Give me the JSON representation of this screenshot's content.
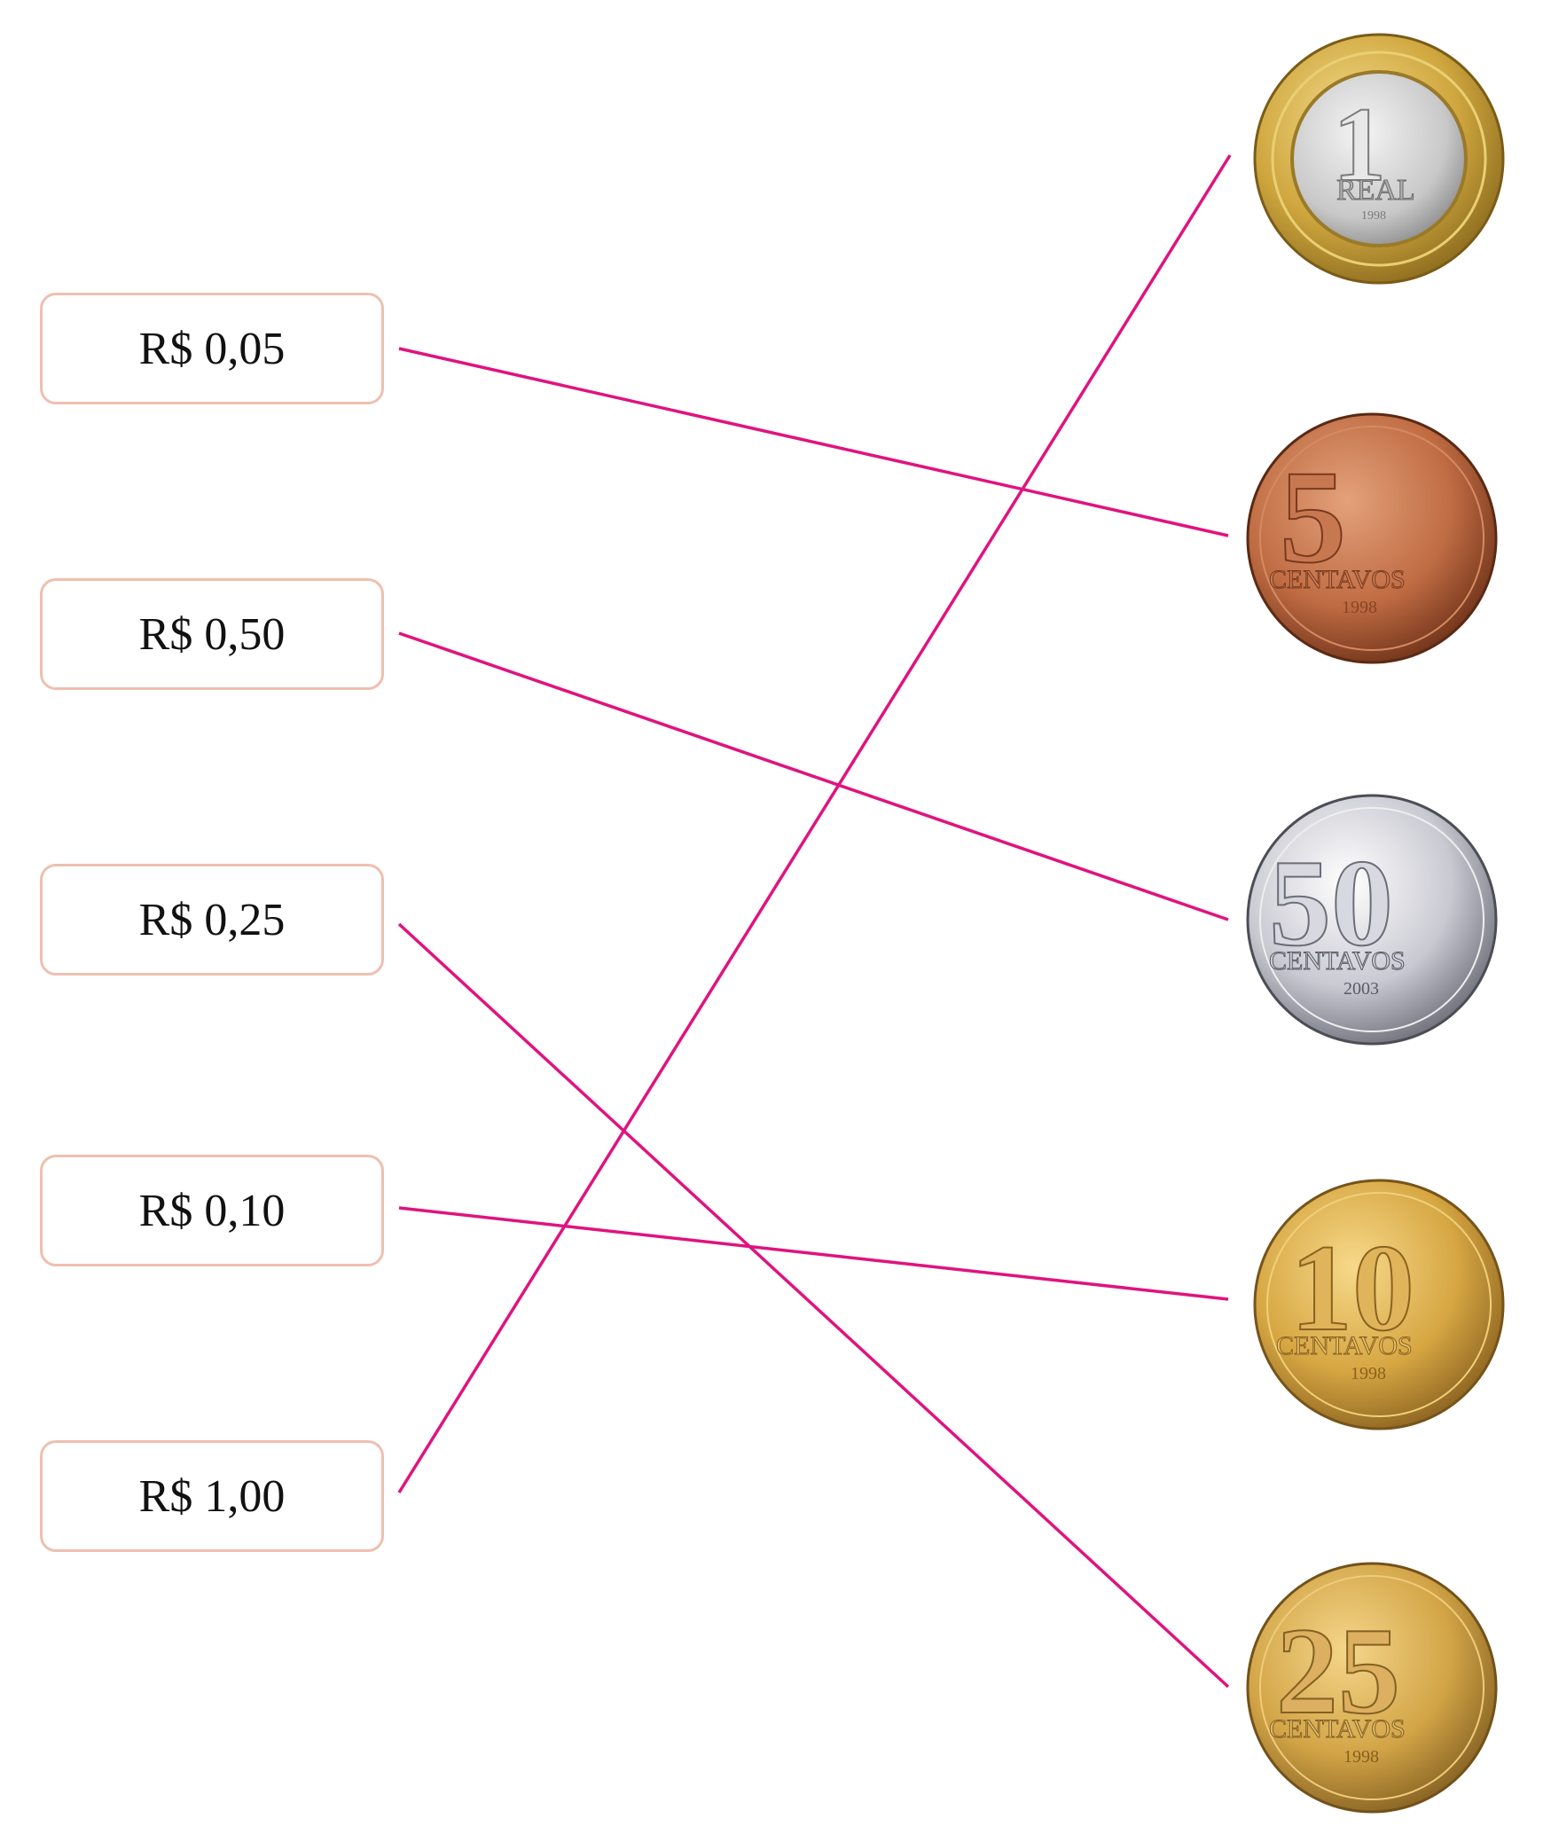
{
  "labels": [
    {
      "id": "0-05",
      "text": "R$ 0,05"
    },
    {
      "id": "0-50",
      "text": "R$ 0,50"
    },
    {
      "id": "0-25",
      "text": "R$ 0,25"
    },
    {
      "id": "0-10",
      "text": "R$ 0,10"
    },
    {
      "id": "1-00",
      "text": "R$ 1,00"
    }
  ],
  "coins": [
    {
      "id": "1-real",
      "numeral": "1",
      "word": "REAL",
      "year": "1998",
      "metal": "bimetal",
      "outer_color": "#c9a43a",
      "inner_color": "#cfcfcf"
    },
    {
      "id": "5-centavos",
      "numeral": "5",
      "word": "CENTAVOS",
      "year": "1998",
      "metal": "copper",
      "outer_color": "#b5683f",
      "inner_color": "#c97a4e"
    },
    {
      "id": "50-centavos",
      "numeral": "50",
      "word": "CENTAVOS",
      "year": "2003",
      "metal": "silver",
      "outer_color": "#a9a9b3",
      "inner_color": "#d9d9e0"
    },
    {
      "id": "10-centavos",
      "numeral": "10",
      "word": "CENTAVOS",
      "year": "1998",
      "metal": "brass",
      "outer_color": "#c99a3a",
      "inner_color": "#ddb356"
    },
    {
      "id": "25-centavos",
      "numeral": "25",
      "word": "CENTAVOS",
      "year": "1998",
      "metal": "brass",
      "outer_color": "#c99a3a",
      "inner_color": "#ddb356"
    }
  ],
  "matches": [
    {
      "label": "R$ 0,05",
      "coin": "5-centavos"
    },
    {
      "label": "R$ 0,50",
      "coin": "50-centavos"
    },
    {
      "label": "R$ 0,25",
      "coin": "25-centavos"
    },
    {
      "label": "R$ 0,10",
      "coin": "10-centavos"
    },
    {
      "label": "R$ 1,00",
      "coin": "1-real"
    }
  ],
  "line_color": "#e0137f"
}
